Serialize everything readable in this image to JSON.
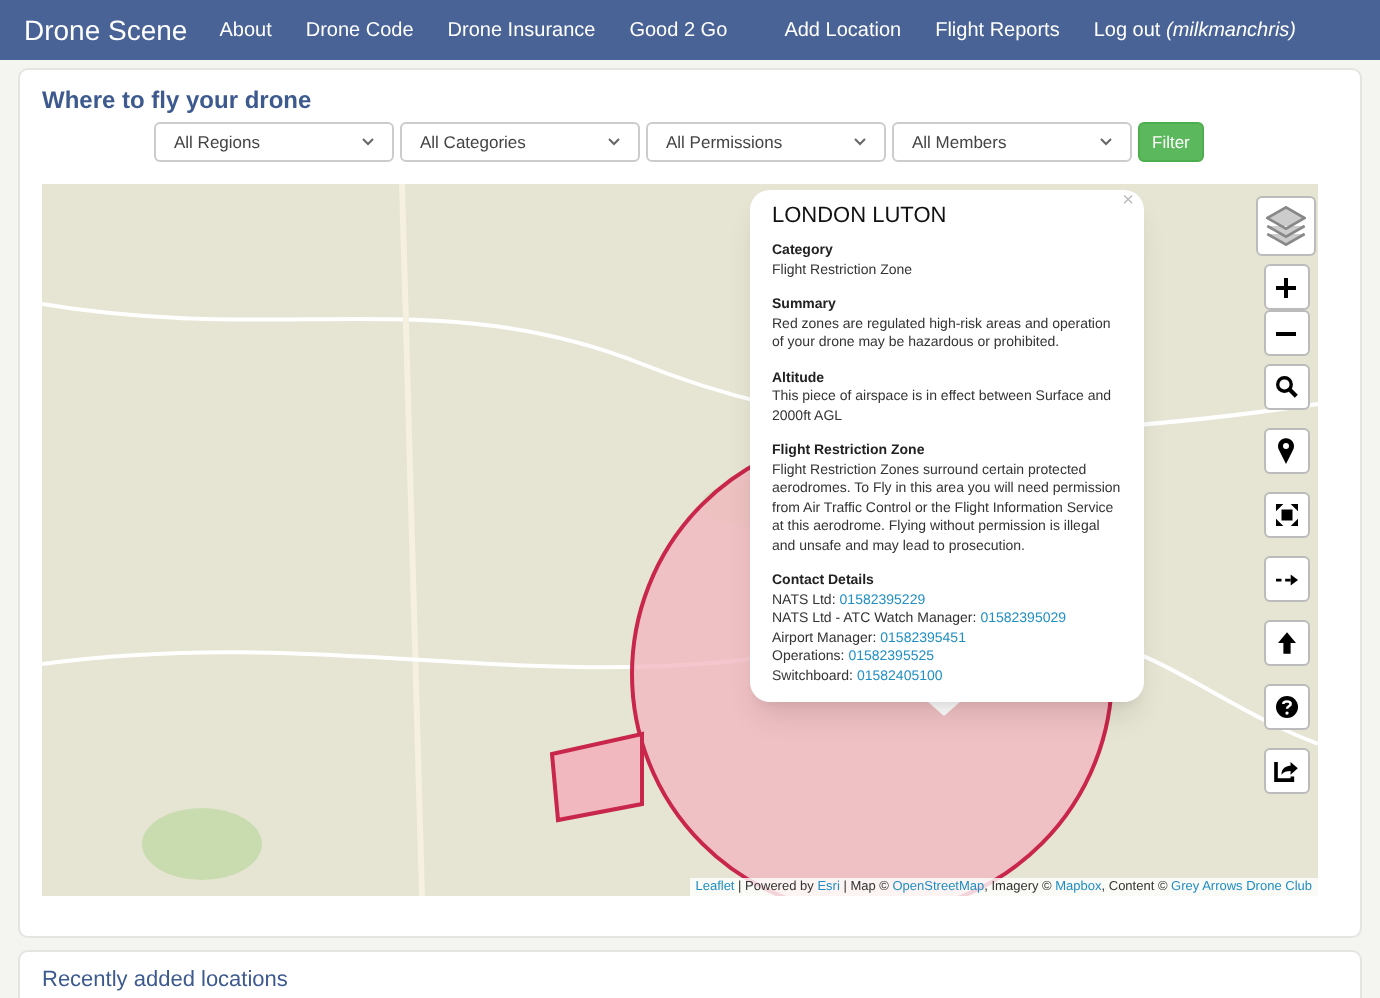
{
  "navbar": {
    "brand": "Drone Scene",
    "left": [
      "About",
      "Drone Code",
      "Drone Insurance",
      "Good 2 Go"
    ],
    "right": [
      "Add Location",
      "Flight Reports",
      "Log out *(milkmanchris)*"
    ]
  },
  "map_card": {
    "title": "Where to fly your drone",
    "filters": [
      {
        "value": "All Regions"
      },
      {
        "value": "All Categories"
      },
      {
        "value": "All Permissions"
      },
      {
        "value": "All Members"
      }
    ],
    "filter_button": "Filter",
    "popup": {
      "close": "×",
      "title": "LONDON LUTON",
      "sections": [
        {
          "heading": "Category",
          "text": "Flight Restriction Zone"
        },
        {
          "heading": "Summary",
          "text": "Red zones are regulated high-risk areas and operation of your drone may be hazardous or prohibited."
        },
        {
          "heading": "Altitude",
          "text": "This piece of airspace is in effect between Surface and 2000ft AGL"
        },
        {
          "heading": "Flight Restriction Zone",
          "text": "Flight Restriction Zones surround certain protected aerodromes. To Fly in this area you will need permission from Air Traffic Control or the Flight Information Service at this aerodrome. Flying without permission is illegal and unsafe and may lead to prosecution."
        }
      ],
      "contacts_heading": "Contact Details",
      "contacts": [
        {
          "label": "NATS Ltd:",
          "number": "01582395229"
        },
        {
          "label": "NATS Ltd - ATC Watch Manager:",
          "number": "01582395029"
        },
        {
          "label": "Airport Manager:",
          "number": "01582395451"
        },
        {
          "label": "Operations:",
          "number": "01582395525"
        },
        {
          "label": "Switchboard:",
          "number": "01582405100"
        }
      ]
    },
    "attribution": [
      {
        "kind": "link",
        "text": "Leaflet"
      },
      {
        "kind": "text",
        "text": " | Powered by "
      },
      {
        "kind": "link",
        "text": "Esri"
      },
      {
        "kind": "text",
        "text": " | Map © "
      },
      {
        "kind": "link",
        "text": "OpenStreetMap"
      },
      {
        "kind": "text",
        "text": ", Imagery © "
      },
      {
        "kind": "link",
        "text": "Mapbox"
      },
      {
        "kind": "text",
        "text": ", Content © "
      },
      {
        "kind": "link",
        "text": "Grey Arrows Drone Club"
      }
    ]
  },
  "recent_card": {
    "title": "Recently added locations"
  }
}
